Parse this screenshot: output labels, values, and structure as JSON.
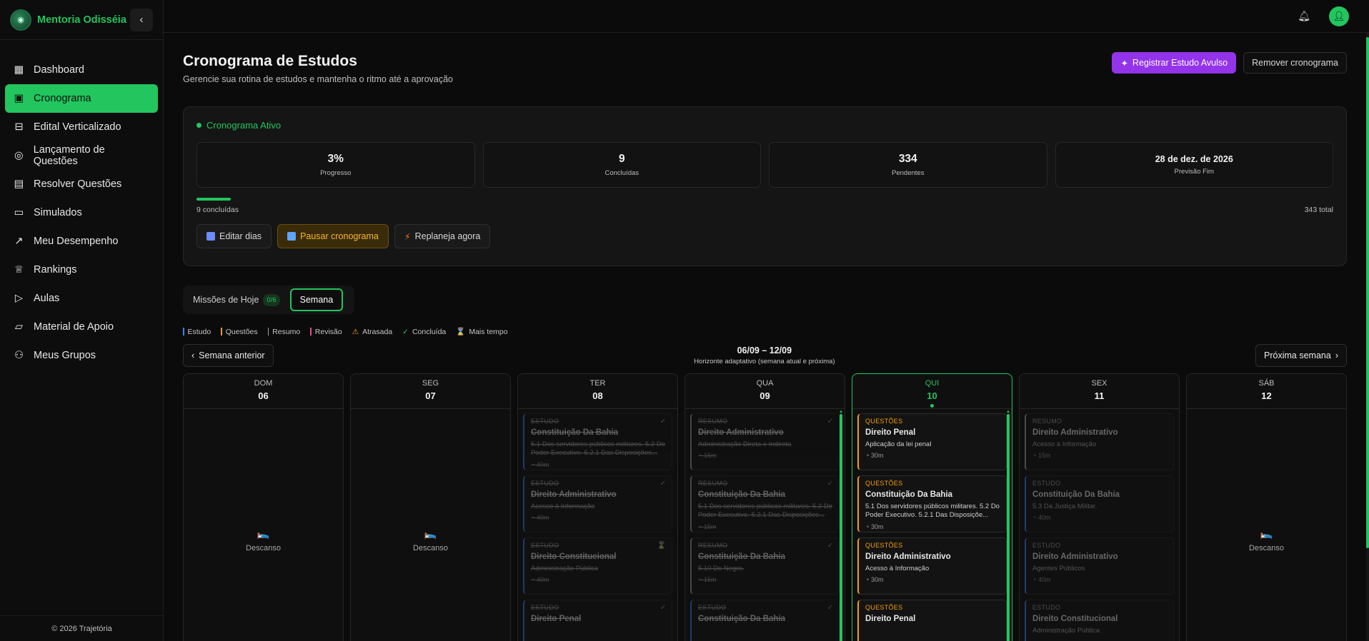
{
  "sidebar": {
    "brand": "Mentoria Odisséia",
    "items": [
      {
        "label": "Dashboard",
        "icon": "dashboard-icon"
      },
      {
        "label": "Cronograma",
        "icon": "calendar-icon",
        "active": true
      },
      {
        "label": "Edital Verticalizado",
        "icon": "book-icon"
      },
      {
        "label": "Lançamento de Questões",
        "icon": "target-icon"
      },
      {
        "label": "Resolver Questões",
        "icon": "notebook-icon"
      },
      {
        "label": "Simulados",
        "icon": "document-icon"
      },
      {
        "label": "Meu Desempenho",
        "icon": "trend-icon"
      },
      {
        "label": "Rankings",
        "icon": "trophy-icon"
      },
      {
        "label": "Aulas",
        "icon": "video-icon"
      },
      {
        "label": "Material de Apoio",
        "icon": "folder-icon"
      },
      {
        "label": "Meus Grupos",
        "icon": "users-icon"
      }
    ],
    "footer": "© 2026 Trajetória"
  },
  "header": {
    "title": "Cronograma de Estudos",
    "subtitle": "Gerencie sua rotina de estudos e mantenha o ritmo até a aprovação",
    "register_label": "Registrar Estudo Avulso",
    "remove_label": "Remover cronograma"
  },
  "status": {
    "label": "Cronograma Ativo",
    "stats": [
      {
        "value": "3%",
        "label": "Progresso"
      },
      {
        "value": "9",
        "label": "Concluídas"
      },
      {
        "value": "334",
        "label": "Pendentes"
      },
      {
        "value": "28 de dez. de 2026",
        "label": "Previsão Fim"
      }
    ],
    "progress_fraction": 0.03,
    "done_text": "9 concluídas",
    "total_text": "343 total",
    "actions": {
      "edit": "Editar dias",
      "pause": "Pausar cronograma",
      "replan": "Replaneja agora"
    }
  },
  "tabs": {
    "today_label": "Missões de Hoje",
    "today_badge": "0/6",
    "week_label": "Semana"
  },
  "legend": [
    {
      "label": "Estudo",
      "color": "#3b82f6"
    },
    {
      "label": "Questões",
      "color": "#f59e0b"
    },
    {
      "label": "Resumo",
      "color": "#a3a3a3"
    },
    {
      "label": "Revisão",
      "color": "#ec4899"
    },
    {
      "label": "Atrasada",
      "symbol": "⚠",
      "color": "#f59e0b"
    },
    {
      "label": "Concluída",
      "symbol": "✓",
      "color": "#22c55e"
    },
    {
      "label": "Mais tempo",
      "symbol": "⌛",
      "color": "#d4d4d4"
    }
  ],
  "week": {
    "prev_label": "Semana anterior",
    "next_label": "Próxima semana",
    "range": "06/09 – 12/09",
    "hint": "Horizonte adaptativo (semana atual e próxima)",
    "rest_label": "Descanso"
  },
  "days": [
    {
      "name": "DOM",
      "num": "06",
      "rest": true,
      "tasks": []
    },
    {
      "name": "SEG",
      "num": "07",
      "rest": true,
      "tasks": []
    },
    {
      "name": "TER",
      "num": "08",
      "tasks": [
        {
          "kind": "ESTUDO",
          "title": "Constituição Da Bahia",
          "sub": "5.1 Dos servidores públicos militares. 5.2 Do Poder Executivo. 5.2.1 Das Disposições...",
          "dur": "40m",
          "done": true,
          "mark": "✓"
        },
        {
          "kind": "ESTUDO",
          "title": "Direito Administrativo",
          "sub": "Acesso à Informação",
          "dur": "40m",
          "done": true,
          "mark": "✓"
        },
        {
          "kind": "ESTUDO",
          "title": "Direito Constitucional",
          "sub": "Administração Pública",
          "dur": "40m",
          "done": true,
          "mark": "⌛"
        },
        {
          "kind": "ESTUDO",
          "title": "Direito Penal",
          "sub": "",
          "dur": "",
          "done": true,
          "mark": "✓"
        }
      ]
    },
    {
      "name": "QUA",
      "num": "09",
      "tasks": [
        {
          "kind": "RESUMO",
          "title": "Direito Administrativo",
          "sub": "Administração Direta e Indireta",
          "dur": "15m",
          "done": true,
          "mark": "✓"
        },
        {
          "kind": "RESUMO",
          "title": "Constituição Da Bahia",
          "sub": "5.1 Dos servidores públicos militares. 5.2 Do Poder Executivo. 5.2.1 Das Disposições...",
          "dur": "15m",
          "done": true,
          "mark": "✓"
        },
        {
          "kind": "RESUMO",
          "title": "Constituição Da Bahia",
          "sub": "5.10 Do Negro.",
          "dur": "15m",
          "done": true,
          "mark": "✓"
        },
        {
          "kind": "ESTUDO",
          "title": "Constituição Da Bahia",
          "sub": "",
          "dur": "",
          "done": true,
          "mark": "✓"
        }
      ]
    },
    {
      "name": "QUI",
      "num": "10",
      "today": true,
      "tasks": [
        {
          "kind": "QUESTÕES",
          "title": "Direito Penal",
          "sub": "Aplicação da lei penal",
          "dur": "30m"
        },
        {
          "kind": "QUESTÕES",
          "title": "Constituição Da Bahia",
          "sub": "5.1 Dos servidores públicos militares. 5.2 Do Poder Executivo. 5.2.1 Das Disposiçõe...",
          "dur": "30m"
        },
        {
          "kind": "QUESTÕES",
          "title": "Direito Administrativo",
          "sub": "Acesso à Informação",
          "dur": "30m"
        },
        {
          "kind": "QUESTÕES",
          "title": "Direito Penal",
          "sub": "",
          "dur": ""
        }
      ]
    },
    {
      "name": "SEX",
      "num": "11",
      "tasks": [
        {
          "kind": "RESUMO",
          "title": "Direito Administrativo",
          "sub": "Acesso à Informação",
          "dur": "15m",
          "faded": true
        },
        {
          "kind": "ESTUDO",
          "title": "Constituição Da Bahia",
          "sub": "5.3 Da Justiça Militar.",
          "dur": "40m",
          "faded": true
        },
        {
          "kind": "ESTUDO",
          "title": "Direito Administrativo",
          "sub": "Agentes Públicos",
          "dur": "40m",
          "faded": true
        },
        {
          "kind": "ESTUDO",
          "title": "Direito Constitucional",
          "sub": "Administração Pública",
          "dur": "",
          "faded": true
        }
      ]
    },
    {
      "name": "SÁB",
      "num": "12",
      "rest": true,
      "tasks": []
    }
  ]
}
